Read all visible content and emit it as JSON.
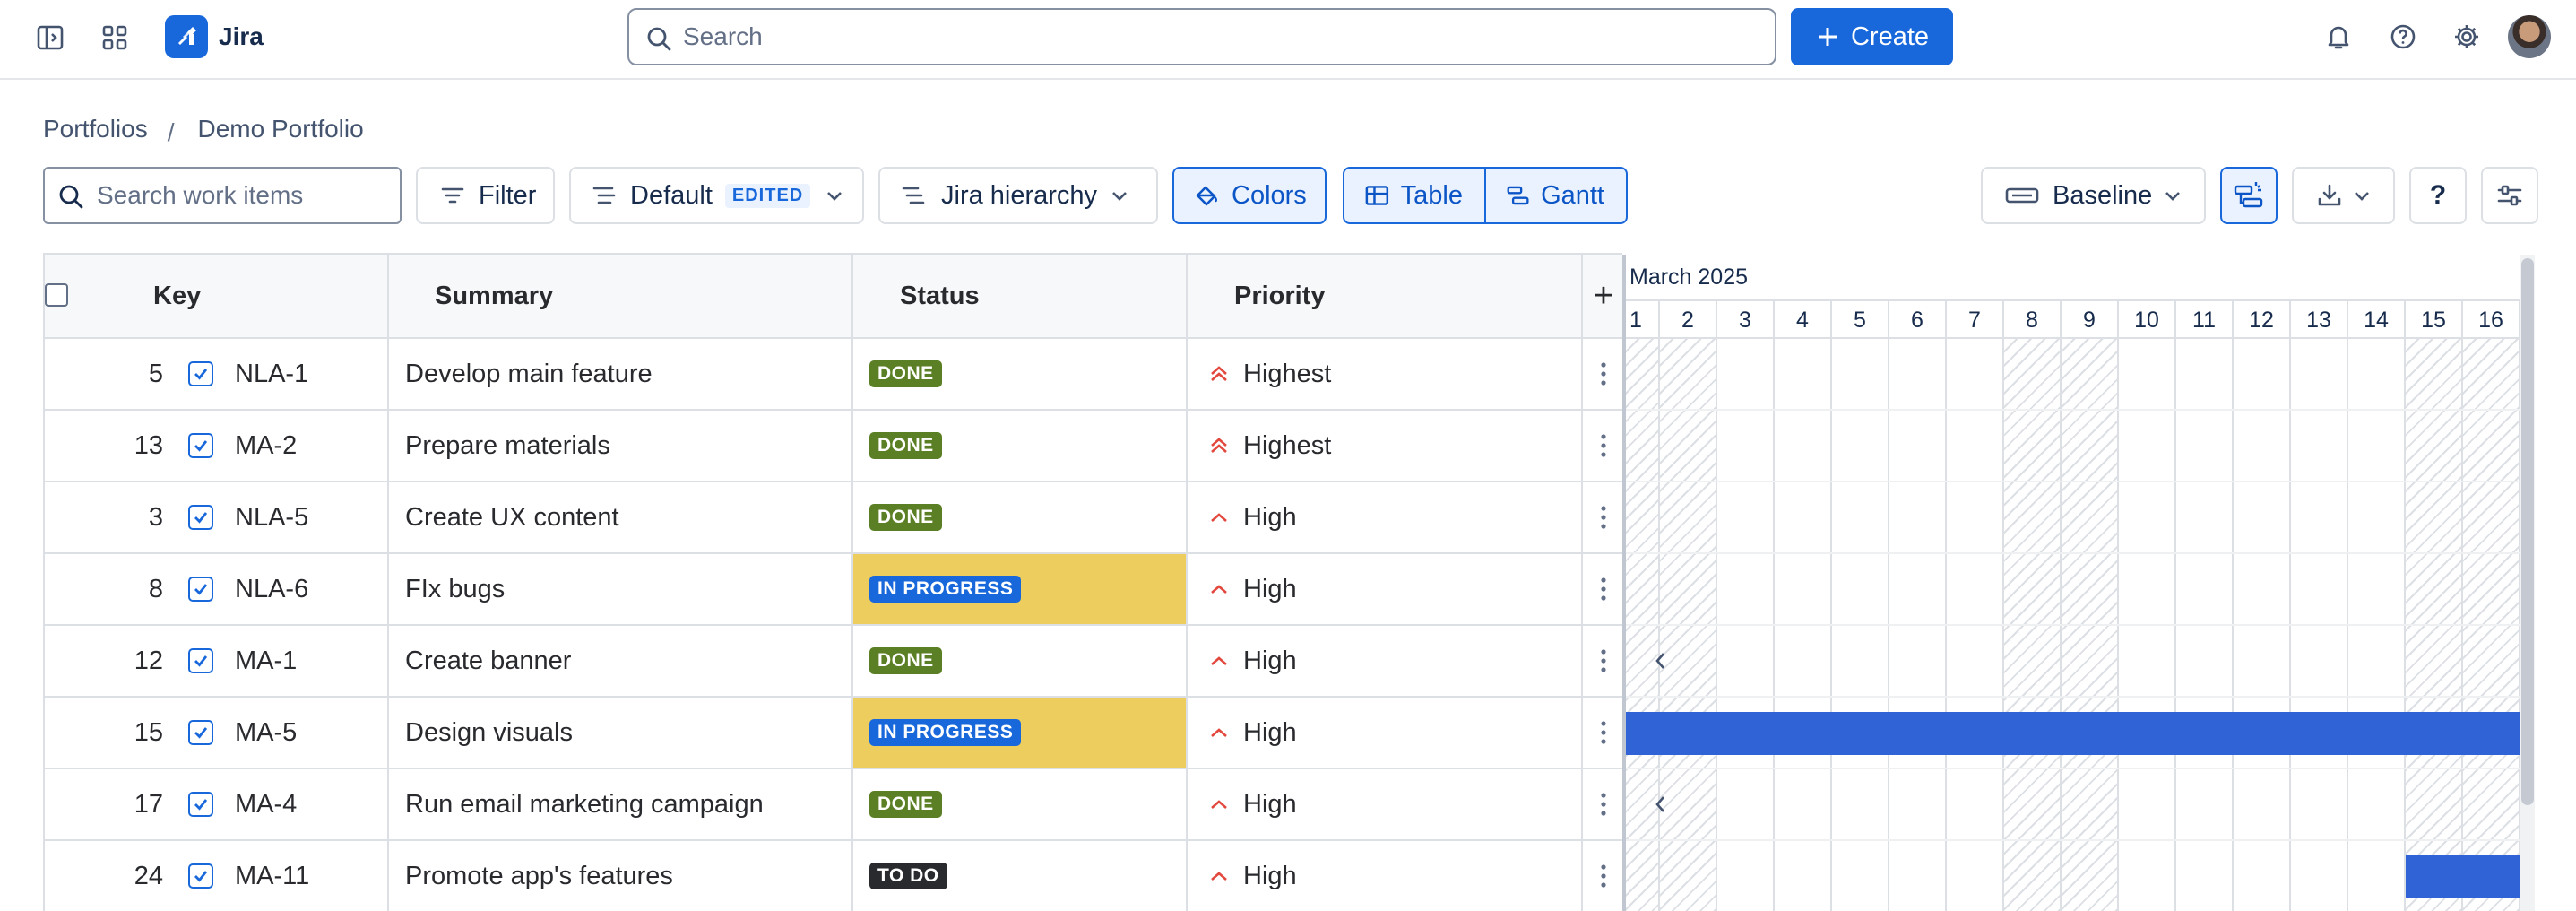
{
  "app": {
    "name": "Jira"
  },
  "nav": {
    "search_placeholder": "Search",
    "create_label": "Create"
  },
  "breadcrumb": {
    "parent": "Portfolios",
    "separator": "/",
    "current": "Demo Portfolio"
  },
  "toolbar": {
    "search_placeholder": "Search work items",
    "filter_label": "Filter",
    "view_label": "Default",
    "view_badge": "EDITED",
    "hierarchy_label": "Jira hierarchy",
    "colors_label": "Colors",
    "table_label": "Table",
    "gantt_label": "Gantt",
    "baseline_label": "Baseline",
    "help_label": "?"
  },
  "table": {
    "columns": {
      "key": "Key",
      "summary": "Summary",
      "status": "Status",
      "priority": "Priority",
      "add": "+"
    },
    "rows": [
      {
        "rank": "5",
        "key": "NLA-1",
        "summary": "Develop main feature",
        "status": "DONE",
        "priority": "Highest"
      },
      {
        "rank": "13",
        "key": "MA-2",
        "summary": "Prepare materials",
        "status": "DONE",
        "priority": "Highest"
      },
      {
        "rank": "3",
        "key": "NLA-5",
        "summary": "Create UX content",
        "status": "DONE",
        "priority": "High"
      },
      {
        "rank": "8",
        "key": "NLA-6",
        "summary": "FIx bugs",
        "status": "IN PROGRESS",
        "priority": "High"
      },
      {
        "rank": "12",
        "key": "MA-1",
        "summary": "Create banner",
        "status": "DONE",
        "priority": "High"
      },
      {
        "rank": "15",
        "key": "MA-5",
        "summary": "Design visuals",
        "status": "IN PROGRESS",
        "priority": "High"
      },
      {
        "rank": "17",
        "key": "MA-4",
        "summary": "Run email marketing campaign",
        "status": "DONE",
        "priority": "High"
      },
      {
        "rank": "24",
        "key": "MA-11",
        "summary": "Promote app's features",
        "status": "TO DO",
        "priority": "High"
      }
    ]
  },
  "gantt": {
    "month": "March 2025",
    "days": [
      "1",
      "2",
      "3",
      "4",
      "5",
      "6",
      "7",
      "8",
      "9",
      "10",
      "11",
      "12",
      "13",
      "14",
      "15",
      "16"
    ]
  },
  "colors": {
    "done": "#5b7f24",
    "in_progress": "#1868db",
    "todo": "#292a2e",
    "in_progress_fill": "#eecd5f",
    "accent": "#1868db",
    "priority": "#e2483d",
    "gantt_bar": "#2f63d6"
  }
}
